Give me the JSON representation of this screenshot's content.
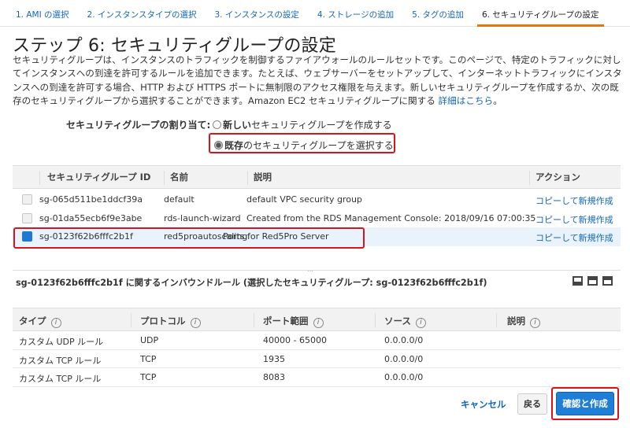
{
  "tabs": [
    {
      "label": "1. AMI の選択"
    },
    {
      "label": "2. インスタンスタイプの選択"
    },
    {
      "label": "3. インスタンスの設定"
    },
    {
      "label": "4. ストレージの追加"
    },
    {
      "label": "5. タグの追加"
    },
    {
      "label": "6. セキュリティグループの設定"
    }
  ],
  "page": {
    "title": "ステップ 6: セキュリティグループの設定",
    "description": "セキュリティグループは、インスタンスのトラフィックを制御するファイアウォールのルールセットです。このページで、特定のトラフィックに対してインスタンスへの到達を許可するルールを追加できます。たとえば、ウェブサーバーをセットアップして、インターネットトラフィックにインスタンスへの到達を許可する場合、HTTP および HTTPS ポートに無制限のアクセス権限を与えます。新しいセキュリティグループを作成するか、次の既存のセキュリティグループから選択することができます。Amazon EC2 セキュリティグループに関する ",
    "details_link": "詳細はこちら",
    "details_suffix": "。"
  },
  "assign": {
    "label": "セキュリティグループの割り当て:",
    "new_option_bold": "新しい",
    "new_option_rest": "セキュリティグループを作成する",
    "existing_option_bold": "既存",
    "existing_option_rest": "のセキュリティグループを選択する",
    "selected": "existing"
  },
  "sg_table": {
    "headers": {
      "id": "セキュリティグループ ID",
      "name": "名前",
      "desc": "説明",
      "actions": "アクション"
    },
    "rows": [
      {
        "id": "sg-065d511be1ddcf39a",
        "name": "default",
        "desc": "default VPC security group",
        "action": "コピーして新規作成",
        "selected": false
      },
      {
        "id": "sg-01da55ecb6f9e3abe",
        "name": "rds-launch-wizard",
        "desc": "Created from the RDS Management Console: 2018/09/16 07:00:35",
        "action": "コピーして新規作成",
        "selected": false
      },
      {
        "id": "sg-0123f62b6fffc2b1f",
        "name": "red5proautoscaling",
        "desc": "Ports for Red5Pro Server",
        "action": "コピーして新規作成",
        "selected": true
      }
    ]
  },
  "inbound": {
    "title": "sg-0123f62b6fffc2b1f に関するインバウンドルール (選択したセキュリティグループ: sg-0123f62b6fffc2b1f)",
    "headers": {
      "type": "タイプ",
      "protocol": "プロトコル",
      "port": "ポート範囲",
      "source": "ソース",
      "desc": "説明"
    },
    "info_glyph": "i",
    "rows": [
      {
        "type": "カスタム UDP ルール",
        "protocol": "UDP",
        "port": "40000 - 65000",
        "source": "0.0.0.0/0"
      },
      {
        "type": "カスタム TCP ルール",
        "protocol": "TCP",
        "port": "1935",
        "source": "0.0.0.0/0"
      },
      {
        "type": "カスタム TCP ルール",
        "protocol": "TCP",
        "port": "8083",
        "source": "0.0.0.0/0"
      }
    ]
  },
  "footer": {
    "cancel": "キャンセル",
    "back": "戻る",
    "review": "確認と作成"
  },
  "colors": {
    "link": "#1166bb",
    "highlight": "#d9141e",
    "primary": "#1f7fd6",
    "tab_active": "#ec7211"
  }
}
